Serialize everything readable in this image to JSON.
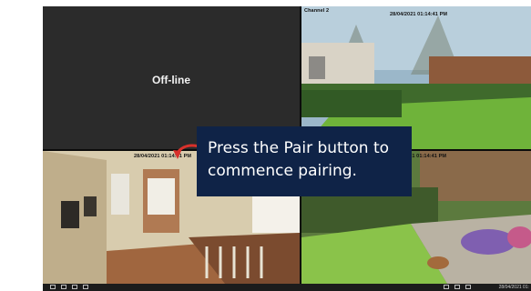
{
  "tiles": [
    {
      "status": "Off-line"
    },
    {
      "channel": "Channel 2",
      "timestamp": "28/04/2021 01:14:41 PM"
    },
    {
      "timestamp": "28/04/2021 01:14:41 PM"
    },
    {
      "timestamp": "28/04/2021 01:14:41 PM"
    }
  ],
  "taskbar": {
    "time": "28/04/2021 01:"
  },
  "callout": {
    "text": "Press the Pair button to commence pairing."
  },
  "colors": {
    "callout_bg": "#0f2347",
    "arrow": "#d8312b",
    "offline_bg": "#2b2b2b"
  }
}
